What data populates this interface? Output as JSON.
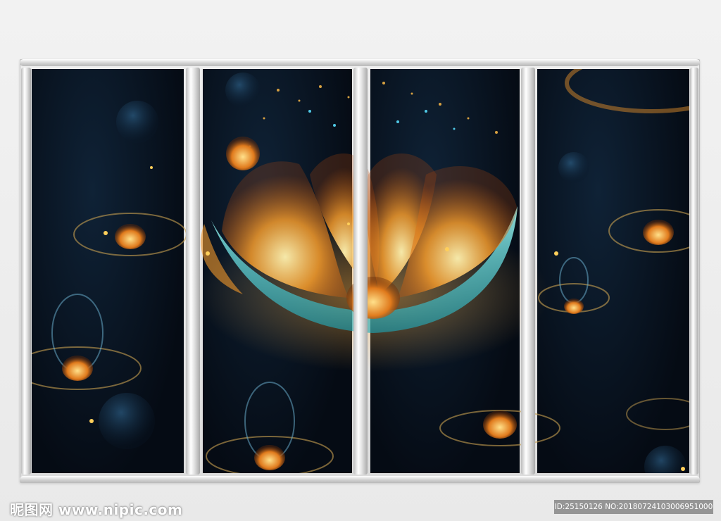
{
  "watermark": {
    "site": "昵图网 www.nipic.com",
    "id_line": "ID:25150126 NO:20180724103006951000"
  },
  "artwork": {
    "panels": 4,
    "colors": {
      "background": "#050b14",
      "flower_orange": "#f39a2b",
      "flower_cyan": "#4fe6e0",
      "frame": "#d9d9d9"
    }
  }
}
